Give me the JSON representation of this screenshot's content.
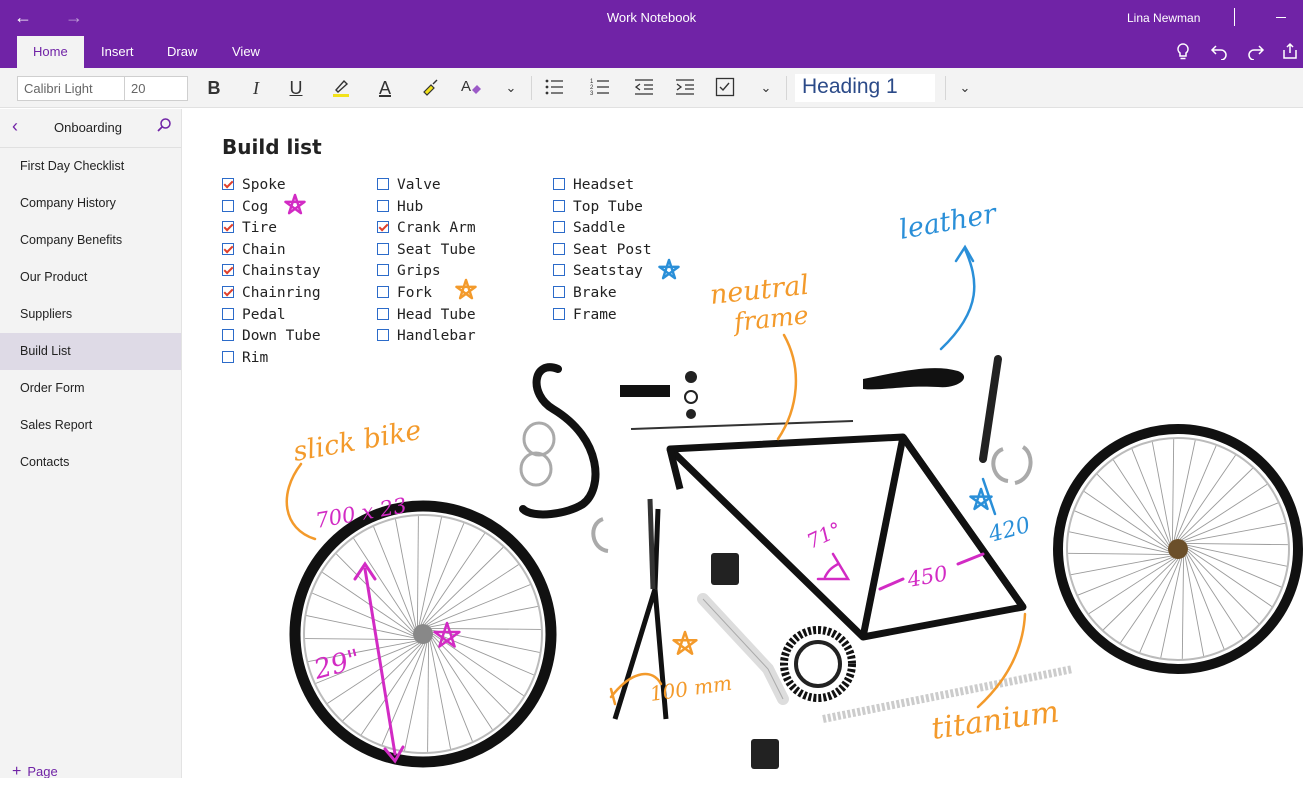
{
  "titlebar": {
    "back": "←",
    "forward": "→",
    "title": "Work Notebook",
    "user": "Lina Newman"
  },
  "ribbon": {
    "tabs": [
      "Home",
      "Insert",
      "Draw",
      "View"
    ],
    "active_tab": "Home"
  },
  "toolbar": {
    "font_name": "Calibri Light",
    "font_size": "20",
    "bold": "B",
    "italic": "I",
    "underline": "U",
    "font_color_glyph": "A",
    "style": "Heading 1"
  },
  "sidebar": {
    "section": "Onboarding",
    "pages": [
      "First Day Checklist",
      "Company History",
      "Company Benefits",
      "Our Product",
      "Suppliers",
      "Build List",
      "Order Form",
      "Sales Report",
      "Contacts"
    ],
    "selected_index": 5,
    "add_page": "Page"
  },
  "page": {
    "title": "Build list",
    "columns": [
      [
        {
          "label": "Spoke",
          "checked": true
        },
        {
          "label": "Cog",
          "checked": false
        },
        {
          "label": "Tire",
          "checked": true
        },
        {
          "label": "Chain",
          "checked": true
        },
        {
          "label": "Chainstay",
          "checked": true
        },
        {
          "label": "Chainring",
          "checked": true
        },
        {
          "label": "Pedal",
          "checked": false
        },
        {
          "label": "Down Tube",
          "checked": false
        },
        {
          "label": "Rim",
          "checked": false
        }
      ],
      [
        {
          "label": "Valve",
          "checked": false
        },
        {
          "label": "Hub",
          "checked": false
        },
        {
          "label": "Crank Arm",
          "checked": true
        },
        {
          "label": "Seat Tube",
          "checked": false
        },
        {
          "label": "Grips",
          "checked": false
        },
        {
          "label": "Fork",
          "checked": false
        },
        {
          "label": "Head Tube",
          "checked": false
        },
        {
          "label": "Handlebar",
          "checked": false
        }
      ],
      [
        {
          "label": "Headset",
          "checked": false
        },
        {
          "label": "Top Tube",
          "checked": false
        },
        {
          "label": "Saddle",
          "checked": false
        },
        {
          "label": "Seat Post",
          "checked": false
        },
        {
          "label": "Seatstay",
          "checked": false
        },
        {
          "label": "Brake",
          "checked": false
        },
        {
          "label": "Frame",
          "checked": false
        }
      ]
    ],
    "annotations": {
      "leather": "leather",
      "neutral": "neutral",
      "frame": "frame",
      "slick_bike": "slick bike",
      "tire_size": "700 x 23",
      "angle": "71°",
      "top_len": "450",
      "seat_len": "420",
      "wheel": "29\"",
      "stem": "100 mm",
      "titanium": "titanium"
    }
  },
  "colors": {
    "accent": "#7023a6",
    "ink_orange": "#f39a2b",
    "ink_magenta": "#d22bc4",
    "ink_blue": "#2a8fd8",
    "checkbox": "#2c6bc9",
    "check": "#e0402c"
  }
}
